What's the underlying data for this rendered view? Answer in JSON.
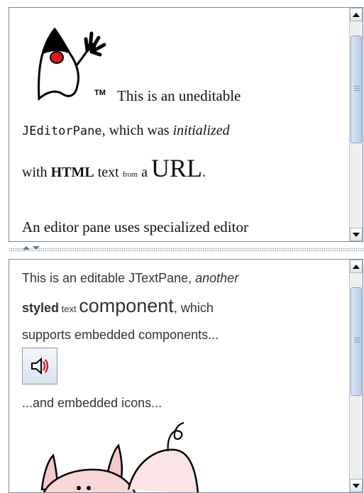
{
  "editor_pane": {
    "line1": "This is an uneditable",
    "line2_mono": "JEditorPane",
    "line2_rest": ", which was ",
    "line2_italic": "initialized",
    "line3_with": "with ",
    "line3_bold": "HTML",
    "line3_text": " text ",
    "line3_small": "from",
    "line3_a": " a ",
    "line3_big": "URL",
    "line3_period": ".",
    "line4": "An editor pane uses specialized editor",
    "tm_mark": "TM"
  },
  "text_pane": {
    "line1_prefix": "This is an editable JTextPane, ",
    "line1_italic": "another",
    "line2_bold": "styled",
    "line2_small": " text ",
    "line2_big": "component",
    "line2_rest": ", which",
    "line3": "supports embedded components...",
    "line4": "...and embedded icons..."
  },
  "icons": {
    "duke": "duke-mascot-icon",
    "sound": "speaker-icon",
    "pig": "pig-icon"
  },
  "colors": {
    "scroll_thumb": "#b8cde6",
    "pane_border": "#7a8a99",
    "speaker_red": "#d8201a"
  }
}
